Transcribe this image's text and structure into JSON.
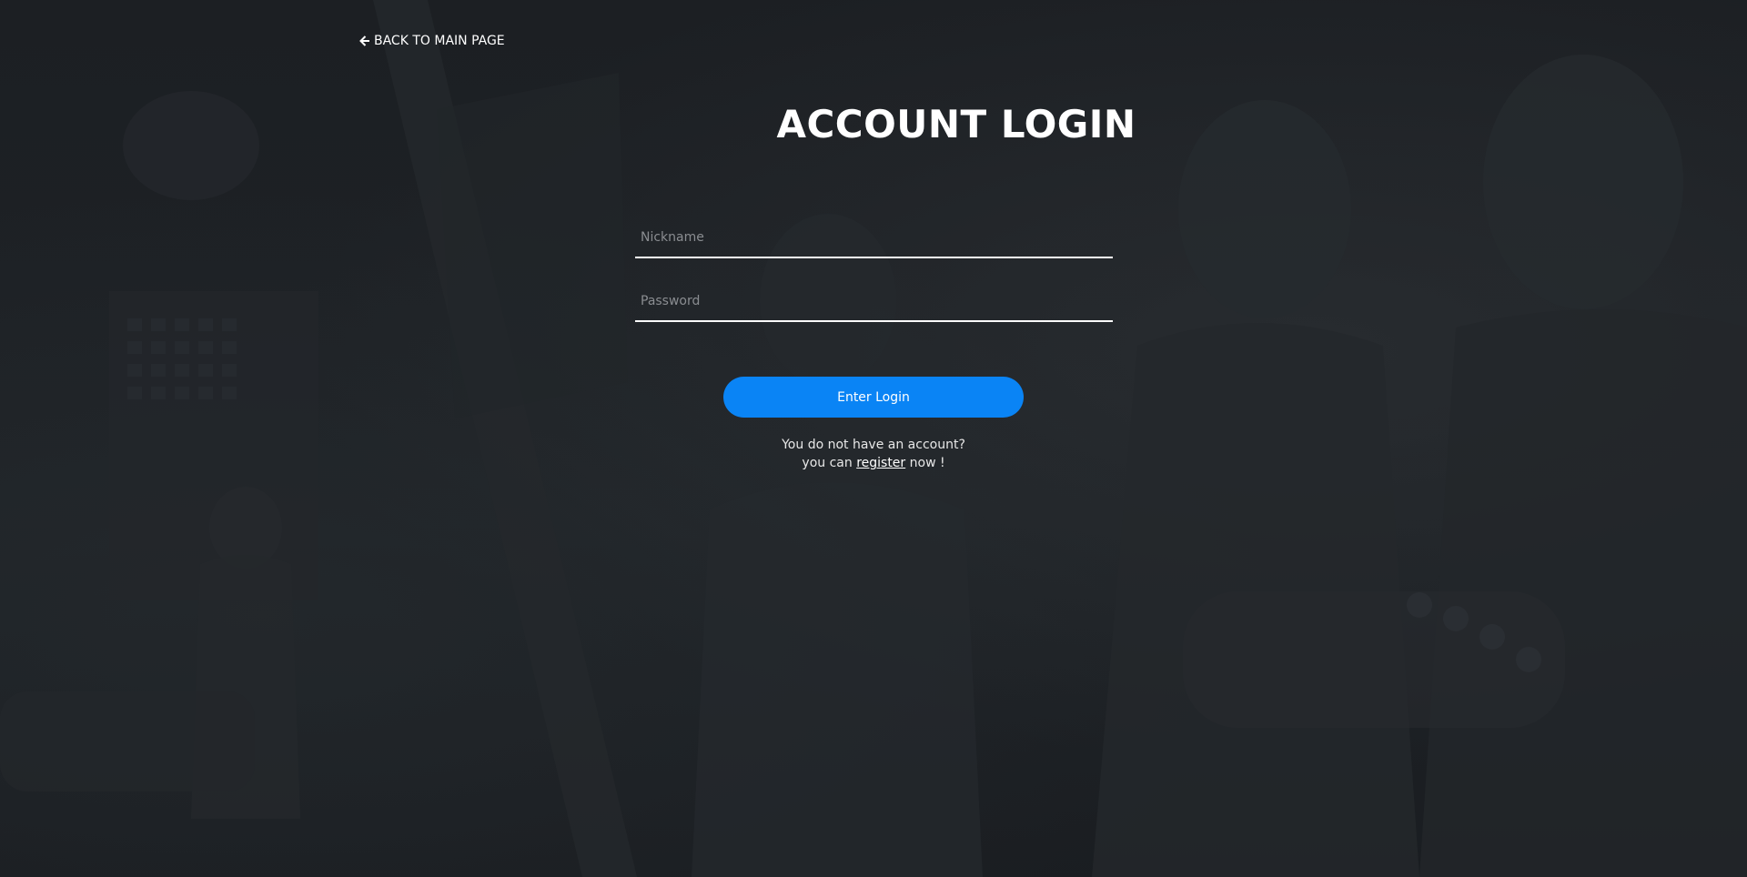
{
  "nav": {
    "back_label": "BACK TO MAIN PAGE",
    "back_icon": "arrow-left-icon"
  },
  "page": {
    "title": "ACCOUNT LOGIN"
  },
  "form": {
    "nickname_placeholder": "Nickname",
    "nickname_value": "",
    "password_placeholder": "Password",
    "password_value": "",
    "submit_label": "Enter Login"
  },
  "register": {
    "line1": "You do not have an account?",
    "prefix": "you can ",
    "link_label": "register",
    "suffix": " now !"
  },
  "colors": {
    "background": "#1b1e22",
    "accent": "#0a84f5",
    "text": "#ffffff"
  }
}
